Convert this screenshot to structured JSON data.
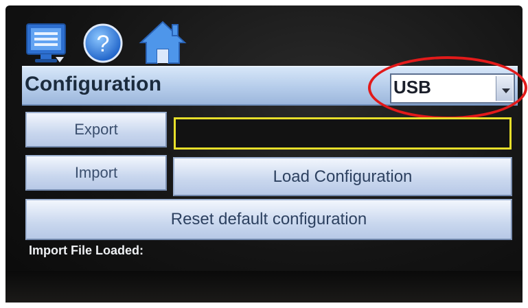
{
  "toolbar": {
    "icons": [
      "monitor-icon",
      "help-icon",
      "home-icon"
    ],
    "help_glyph": "?"
  },
  "header": {
    "title": "Configuration",
    "source_select": {
      "value": "USB"
    }
  },
  "actions": {
    "export_label": "Export",
    "import_label": "Import",
    "load_label": "Load Configuration",
    "reset_label": "Reset default configuration",
    "export_path_value": ""
  },
  "status": {
    "import_file_label": "Import File Loaded:"
  },
  "colors": {
    "header_blue": "#b5ccea",
    "button_blue": "#c9d7ee",
    "field_outline": "#e7df2a",
    "highlight_red": "#e21a1a",
    "screen_background": "#141414"
  }
}
